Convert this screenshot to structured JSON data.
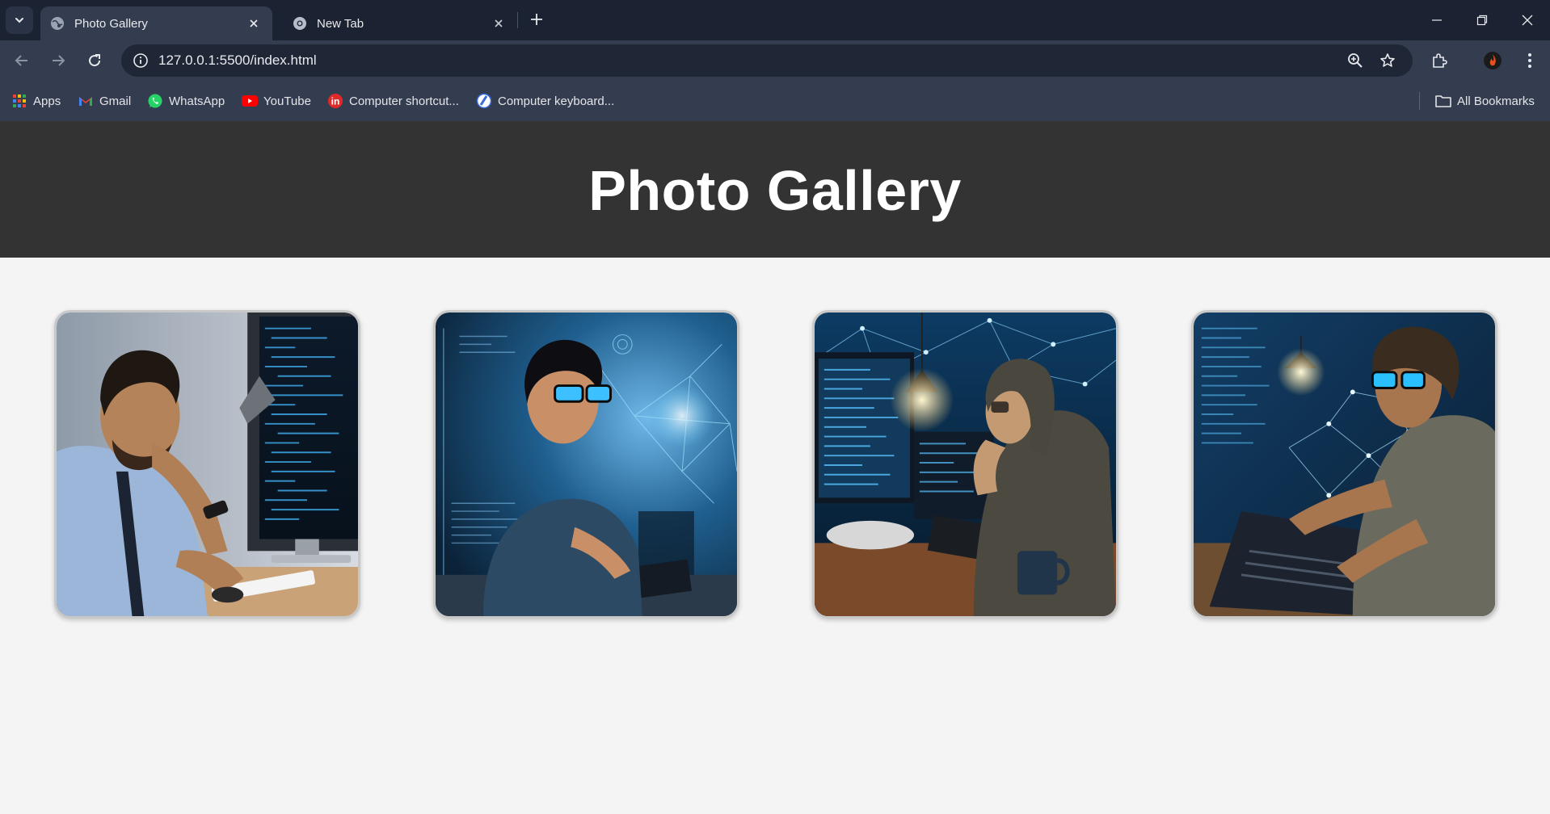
{
  "browser": {
    "tabs": [
      {
        "title": "Photo Gallery",
        "active": true,
        "icon": "globe-icon"
      },
      {
        "title": "New Tab",
        "active": false,
        "icon": "chrome-icon"
      }
    ],
    "url": "127.0.0.1:5500/index.html",
    "bookmarks": [
      {
        "label": "Apps",
        "icon": "apps-grid-icon"
      },
      {
        "label": "Gmail",
        "icon": "gmail-icon"
      },
      {
        "label": "WhatsApp",
        "icon": "whatsapp-icon"
      },
      {
        "label": "YouTube",
        "icon": "youtube-icon"
      },
      {
        "label": "Computer shortcut...",
        "icon": "site-icon"
      },
      {
        "label": "Computer keyboard...",
        "icon": "site-icon"
      }
    ],
    "all_bookmarks_label": "All Bookmarks"
  },
  "page": {
    "title": "Photo Gallery",
    "colors": {
      "header_bg": "#333333",
      "page_bg": "#f4f4f4",
      "title_text": "#ffffff"
    },
    "gallery": [
      {
        "subject": "man in shirt and tie thinking at a computer monitor with code"
      },
      {
        "subject": "young man with glasses coding amid holographic network graphics"
      },
      {
        "subject": "hooded programmer at a desk with monitors and a coffee mug"
      },
      {
        "subject": "man with glasses typing on a laptop with network overlay"
      }
    ]
  }
}
